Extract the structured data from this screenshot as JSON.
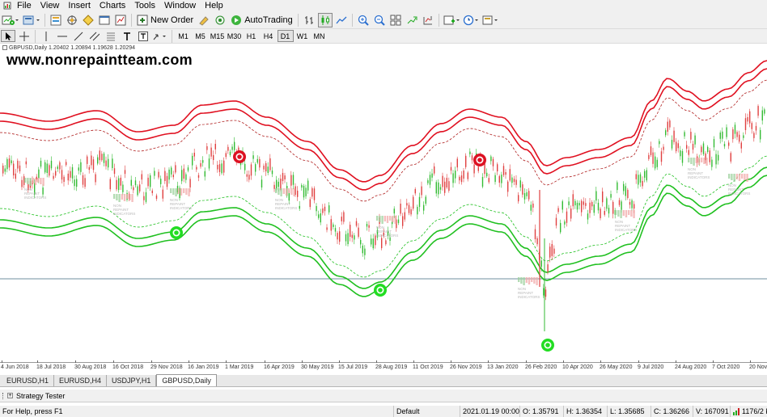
{
  "menu": [
    "File",
    "View",
    "Insert",
    "Charts",
    "Tools",
    "Window",
    "Help"
  ],
  "toolbar": {
    "new_order": "New Order",
    "autotrading": "AutoTrading"
  },
  "timeframes": [
    "M1",
    "M5",
    "M15",
    "M30",
    "H1",
    "H4",
    "D1",
    "W1",
    "MN"
  ],
  "active_timeframe": "D1",
  "chart": {
    "header": "GBPUSD,Daily  1.20402 1.20894 1.19628 1.20294",
    "watermark": "www.nonrepaintteam.com",
    "dates": [
      "4 Jun 2018",
      "18 Jul 2018",
      "30 Aug 2018",
      "16 Oct 2018",
      "29 Nov 2018",
      "16 Jan 2019",
      "1 Mar 2019",
      "16 Apr 2019",
      "30 May 2019",
      "15 Jul 2019",
      "28 Aug 2019",
      "11 Oct 2019",
      "26 Nov 2019",
      "13 Jan 2020",
      "26 Feb 2020",
      "10 Apr 2020",
      "26 May 2020",
      "9 Jul 2020",
      "24 Aug 2020",
      "7 Oct 2020",
      "20 Nov"
    ],
    "colors": {
      "upper_band": "#e01020",
      "lower_band": "#20c020",
      "bull": "#33bb33",
      "bear": "#e04040",
      "level_line": "#6f8f9f"
    },
    "indicator_label": [
      "NON",
      "REPAINT",
      "INDICATORS"
    ]
  },
  "tabs": [
    "EURUSD,H1",
    "EURUSD,H4",
    "USDJPY,H1",
    "GBPUSD,Daily"
  ],
  "active_tab": "GBPUSD,Daily",
  "tester": {
    "label": "Strategy Tester"
  },
  "status": {
    "help": "For Help, press F1",
    "profile": "Default",
    "datetime": "2021.01.19 00:00",
    "open": "O: 1.35791",
    "high": "H: 1.36354",
    "low": "L: 1.35685",
    "close": "C: 1.36266",
    "volume": "V: 167091",
    "traffic": "1176/2 kb"
  }
}
